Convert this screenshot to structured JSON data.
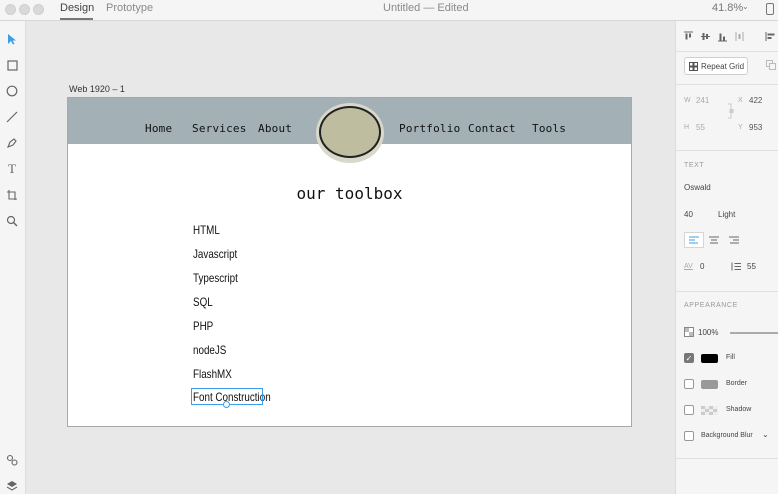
{
  "titlebar": {
    "tabs": [
      "Design",
      "Prototype"
    ],
    "doc_title": "Untitled — Edited",
    "zoom": "41.8%"
  },
  "toolbar": {
    "tools": [
      "select-tool-icon",
      "rectangle-tool-icon",
      "ellipse-tool-icon",
      "line-tool-icon",
      "pen-tool-icon",
      "text-tool-icon",
      "artboard-tool-icon",
      "zoom-tool-icon",
      "plugins-icon",
      "layers-icon"
    ]
  },
  "artboard": {
    "label": "Web 1920 – 1",
    "nav": [
      "Home",
      "Services",
      "About",
      "Portfolio",
      "Contact",
      "Tools"
    ],
    "heading": "our toolbox",
    "items": [
      "HTML",
      "Javascript",
      "Typescript",
      "SQL",
      "PHP",
      "nodeJS",
      "FlashMX",
      "Font Construction"
    ]
  },
  "panel": {
    "repeat_grid": "Repeat Grid",
    "w_label": "W",
    "w_value": "241",
    "h_label": "H",
    "h_value": "55",
    "x_label": "X",
    "x_value": "422",
    "y_label": "Y",
    "y_value": "953",
    "text_title": "TEXT",
    "font": "Oswald",
    "size": "40",
    "weight": "Light",
    "av_label": "AV",
    "char_spacing": "0",
    "line_spacing": "55",
    "appearance_title": "APPEARANCE",
    "opacity": "100%",
    "fill": "Fill",
    "border": "Border",
    "shadow": "Shadow",
    "background_blur": "Background Blur",
    "colors": {
      "fill": "#000000",
      "border": "#999999",
      "navbar": "#a3b1b7",
      "logo": "#bebd9f",
      "selection": "#3d9de6"
    }
  }
}
